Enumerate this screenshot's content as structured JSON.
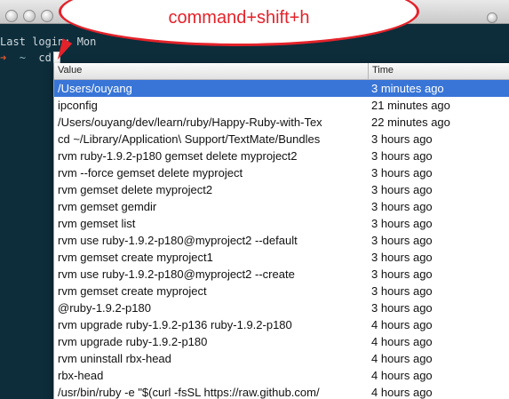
{
  "terminal": {
    "last_login": "Last login: Mon ",
    "prompt_arrow": "➜",
    "prompt_tilde": "~",
    "command": "cd"
  },
  "callout": {
    "text": "command+shift+h"
  },
  "popup": {
    "columns": {
      "value": "Value",
      "time": "Time"
    },
    "rows": [
      {
        "value": "/Users/ouyang",
        "time": "3 minutes ago",
        "selected": true
      },
      {
        "value": "ipconfig",
        "time": "21 minutes ago"
      },
      {
        "value": "/Users/ouyang/dev/learn/ruby/Happy-Ruby-with-Tex",
        "time": "22 minutes ago"
      },
      {
        "value": "cd ~/Library/Application\\ Support/TextMate/Bundles",
        "time": "3 hours ago"
      },
      {
        "value": "rvm ruby-1.9.2-p180 gemset delete myproject2",
        "time": "3 hours ago"
      },
      {
        "value": "rvm --force gemset delete myproject",
        "time": "3 hours ago"
      },
      {
        "value": "rvm gemset delete myproject2",
        "time": "3 hours ago"
      },
      {
        "value": "rvm gemset gemdir",
        "time": "3 hours ago"
      },
      {
        "value": "rvm gemset list",
        "time": "3 hours ago"
      },
      {
        "value": "rvm use ruby-1.9.2-p180@myproject2 --default",
        "time": "3 hours ago"
      },
      {
        "value": "rvm gemset create myproject1",
        "time": "3 hours ago"
      },
      {
        "value": "rvm use ruby-1.9.2-p180@myproject2 --create",
        "time": "3 hours ago"
      },
      {
        "value": "rvm gemset create myproject",
        "time": "3 hours ago"
      },
      {
        "value": "@ruby-1.9.2-p180",
        "time": "3 hours ago"
      },
      {
        "value": "rvm upgrade ruby-1.9.2-p136 ruby-1.9.2-p180",
        "time": "4 hours ago"
      },
      {
        "value": "rvm upgrade ruby-1.9.2-p180",
        "time": "4 hours ago"
      },
      {
        "value": "rvm uninstall rbx-head",
        "time": "4 hours ago"
      },
      {
        "value": "rbx-head",
        "time": "4 hours ago"
      },
      {
        "value": "/usr/bin/ruby -e \"$(curl -fsSL https://raw.github.com/",
        "time": "4 hours ago"
      }
    ]
  }
}
